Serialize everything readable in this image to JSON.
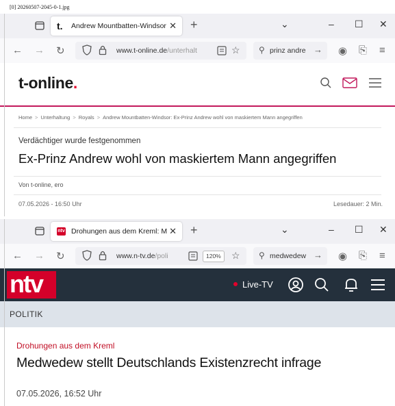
{
  "file_label": "[0] 20260507-2045-0-1.jpg",
  "browser1": {
    "tab": {
      "favicon": "t.",
      "title": "Andrew Mountbatten-Windsor"
    },
    "url_host": "www.t-online.de",
    "url_path": "/unterhalt",
    "search_text": "prinz andre"
  },
  "tonline": {
    "logo": "t-online",
    "logo_dot": ".",
    "breadcrumb": [
      "Home",
      "Unterhaltung",
      "Royals",
      "Andrew Mountbatten-Windsor: Ex-Prinz Andrew wohl von maskiertem Mann angegriffen"
    ],
    "breadcrumb_sep": ">",
    "kicker": "Verdächtiger wurde festgenommen",
    "headline": "Ex-Prinz Andrew wohl von maskiertem Mann angegriffen",
    "author": "Von t-online, ero",
    "date": "07.05.2026 - 16:50 Uhr",
    "read_time": "Lesedauer: 2 Min.",
    "accent_color": "#c2185b"
  },
  "browser2": {
    "tab": {
      "favicon": "ntv",
      "title": "Drohungen aus dem Kreml: Me"
    },
    "url_host": "www.n-tv.de",
    "url_path": "/poli",
    "zoom": "120%",
    "search_text": "medwedew"
  },
  "ntv": {
    "logo": "ntv",
    "live_label": "Live-TV",
    "section": "POLITIK",
    "kicker": "Drohungen aus dem Kreml",
    "headline": "Medwedew stellt Deutschlands Existenzrecht infrage",
    "date": "07.05.2026, 16:52 Uhr",
    "header_bg": "#24303c",
    "brand_red": "#d4002a"
  },
  "icons": {
    "tab_list": "tab-list-icon",
    "close": "close-icon",
    "new_tab": "plus-icon",
    "back": "back-arrow-icon",
    "forward": "forward-arrow-icon",
    "reload": "reload-icon",
    "shield": "shield-icon",
    "lock": "lock-icon",
    "reader": "reader-view-icon",
    "bookmark": "star-icon",
    "search": "search-icon",
    "go": "arrow-right-icon",
    "account": "account-icon",
    "extensions": "puzzle-icon",
    "menu": "hamburger-icon",
    "mail": "mail-icon",
    "bell": "bell-icon",
    "user": "user-icon"
  }
}
